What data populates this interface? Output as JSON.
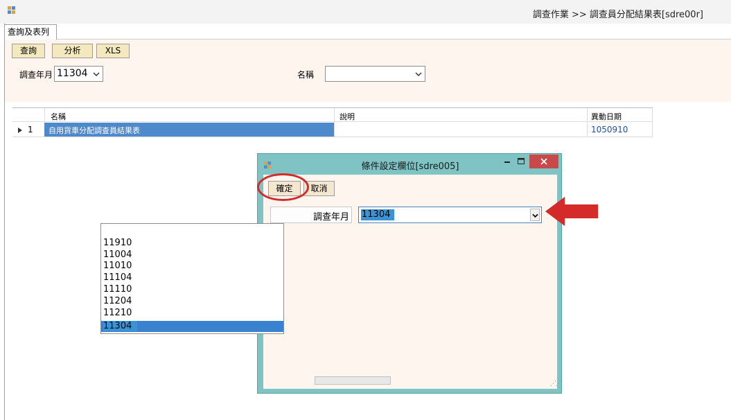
{
  "app": {
    "title": "調查作業 >> 調查員分配結果表[sdre00r]"
  },
  "tabs": [
    {
      "label": "查詢及表列"
    }
  ],
  "toolbar": {
    "query_label": "查詢",
    "analyze_label": "分析",
    "xls_label": "XLS"
  },
  "filters": {
    "month_label": "調查年月",
    "month_value": "11304",
    "name_label": "名稱",
    "name_value": ""
  },
  "grid": {
    "columns": [
      "名稱",
      "說明",
      "異動日期"
    ],
    "rows": [
      {
        "index": "1",
        "name": "自用貨車分配調查員結果表",
        "desc": "",
        "date": "1050910"
      }
    ]
  },
  "dialog": {
    "title": "條件設定欄位[sdre005]",
    "confirm_label": "確定",
    "cancel_label": "取消",
    "field_label": "調查年月",
    "field_value": "11304",
    "options": [
      "11910",
      "11004",
      "11010",
      "11104",
      "11110",
      "11204",
      "11210",
      "11304"
    ],
    "selected_option": "11304"
  },
  "colors": {
    "accent_selection": "#3a82cf",
    "dialog_frame": "#7fc3c4",
    "annotation_red": "#d42a2a"
  }
}
